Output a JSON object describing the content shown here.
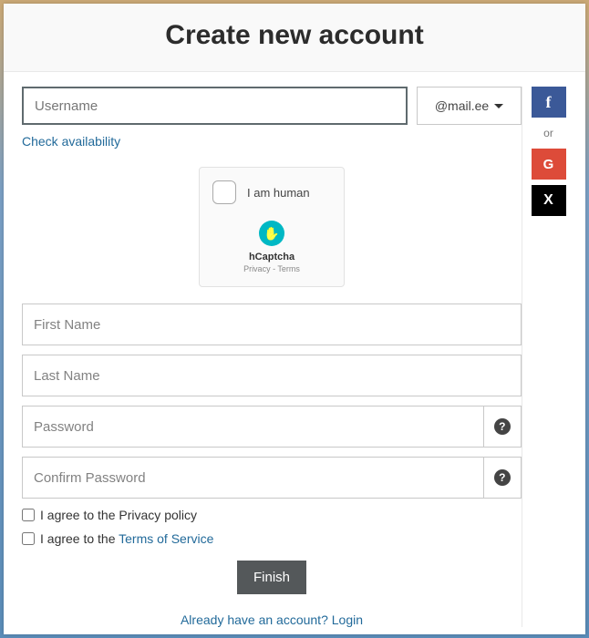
{
  "header": {
    "title": "Create new account"
  },
  "username": {
    "placeholder": "Username",
    "domain": "@mail.ee",
    "check_label": "Check availability"
  },
  "social": {
    "divider": "or",
    "facebook": "f",
    "google": "G",
    "x": "X"
  },
  "captcha": {
    "label": "I am human",
    "brand": "hCaptcha",
    "privacy": "Privacy",
    "terms": "Terms"
  },
  "fields": {
    "first_name": "First Name",
    "last_name": "Last Name",
    "password": "Password",
    "confirm_password": "Confirm Password"
  },
  "agree": {
    "prefix": "I agree to the ",
    "privacy": "Privacy policy",
    "tos": "Terms of Service"
  },
  "actions": {
    "finish": "Finish",
    "already": "Already have an account? ",
    "login": "Login"
  }
}
